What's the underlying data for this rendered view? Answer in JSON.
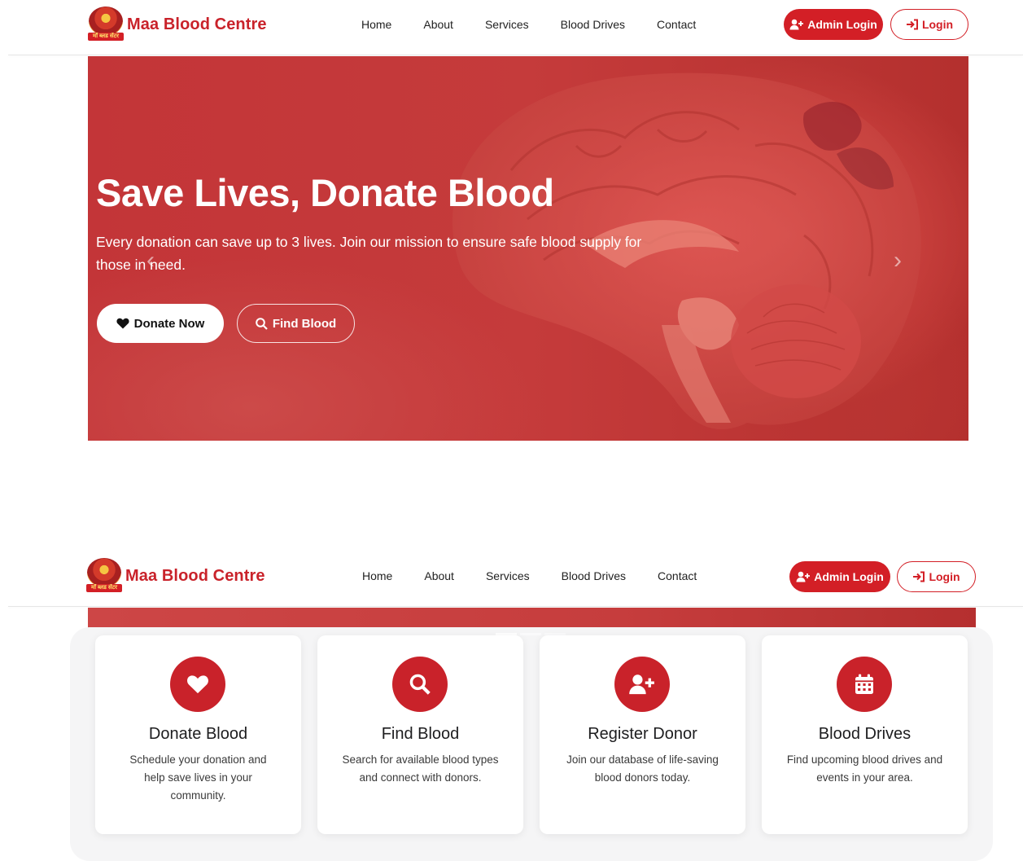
{
  "brand": {
    "name": "Maa Blood Centre",
    "logo_text": "माँ ब्लड सेंटर"
  },
  "nav": {
    "links": [
      "Home",
      "About",
      "Services",
      "Blood Drives",
      "Contact"
    ]
  },
  "actions": {
    "admin_login": "Admin Login",
    "login": "Login"
  },
  "hero": {
    "title": "Save Lives, Donate Blood",
    "text": "Every donation can save up to 3 lives. Join our mission to ensure safe blood supply for those in need.",
    "donate_button": "Donate Now",
    "find_button": "Find Blood",
    "slides_total": 3,
    "active_slide": 1
  },
  "features": [
    {
      "title": "Donate Blood",
      "text": "Schedule your donation and help save lives in your community.",
      "icon": "heart-icon"
    },
    {
      "title": "Find Blood",
      "text": "Search for available blood types and connect with donors.",
      "icon": "search-icon"
    },
    {
      "title": "Register Donor",
      "text": "Join our database of life-saving blood donors today.",
      "icon": "user-plus-icon"
    },
    {
      "title": "Blood Drives",
      "text": "Find upcoming blood drives and events in your area.",
      "icon": "calendar-icon"
    }
  ],
  "colors": {
    "brand_red": "#d31f26",
    "hero_red": "#c33538",
    "section_bg": "#f5f5f6"
  }
}
